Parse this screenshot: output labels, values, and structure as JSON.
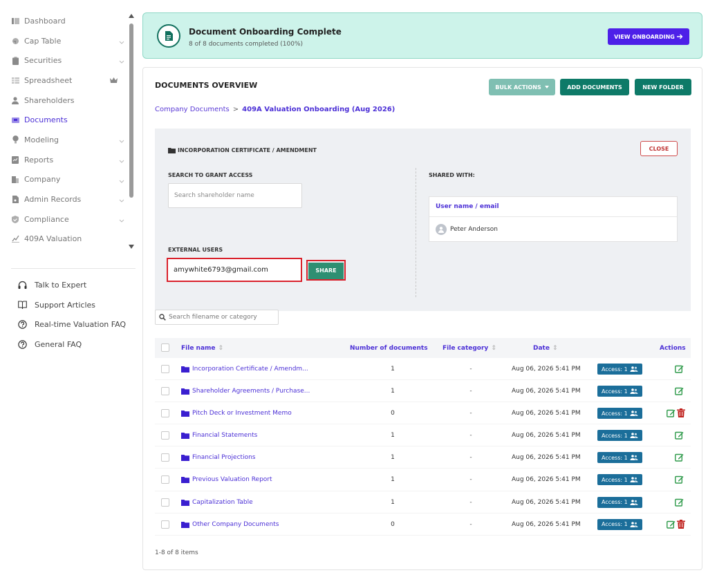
{
  "sidebar": {
    "items": [
      {
        "label": "Dashboard",
        "icon": "dashboard-icon",
        "chevron": false
      },
      {
        "label": "Cap Table",
        "icon": "pie-chart-icon",
        "chevron": true
      },
      {
        "label": "Securities",
        "icon": "clipboard-icon",
        "chevron": true
      },
      {
        "label": "Spreadsheet",
        "icon": "table-icon",
        "chevron": false,
        "badge": "crown-icon"
      },
      {
        "label": "Shareholders",
        "icon": "person-icon",
        "chevron": false
      },
      {
        "label": "Documents",
        "icon": "folder-icon",
        "chevron": false,
        "active": true
      },
      {
        "label": "Modeling",
        "icon": "lightbulb-icon",
        "chevron": true
      },
      {
        "label": "Reports",
        "icon": "report-icon",
        "chevron": true
      },
      {
        "label": "Company",
        "icon": "building-icon",
        "chevron": true
      },
      {
        "label": "Admin Records",
        "icon": "records-icon",
        "chevron": true
      },
      {
        "label": "Compliance",
        "icon": "shield-check-icon",
        "chevron": true
      },
      {
        "label": "409A Valuation",
        "icon": "chart-icon",
        "chevron": false
      }
    ],
    "help": [
      {
        "label": "Talk to Expert",
        "icon": "headset-icon"
      },
      {
        "label": "Support Articles",
        "icon": "book-icon"
      },
      {
        "label": "Real-time Valuation FAQ",
        "icon": "question-icon"
      },
      {
        "label": "General FAQ",
        "icon": "question-icon"
      }
    ]
  },
  "banner": {
    "title": "Document Onboarding Complete",
    "subtitle": "8 of 8 documents completed (100%)",
    "button": "VIEW ONBOARDING"
  },
  "overview": {
    "title": "DOCUMENTS OVERVIEW",
    "bulk_actions": "BULK ACTIONS",
    "add_documents": "ADD DOCUMENTS",
    "new_folder": "NEW FOLDER",
    "breadcrumb": {
      "root": "Company Documents",
      "separator": ">",
      "current": "409A Valuation Onboarding (Aug 2026)"
    }
  },
  "share_panel": {
    "folder_name": "INCORPORATION CERTIFICATE / AMENDMENT",
    "close": "CLOSE",
    "search_label": "SEARCH TO GRANT ACCESS",
    "search_placeholder": "Search shareholder name",
    "external_label": "EXTERNAL USERS",
    "external_value": "amywhite6793@gmail.com",
    "share": "SHARE",
    "shared_with_label": "SHARED WITH:",
    "shared_header": "User name / email",
    "shared_users": [
      "Peter Anderson"
    ]
  },
  "file_search": {
    "placeholder": "Search filename or category"
  },
  "table": {
    "columns": {
      "file_name": "File name",
      "num_docs": "Number of documents",
      "category": "File category",
      "date": "Date",
      "actions": "Actions"
    },
    "rows": [
      {
        "name": "Incorporation Certificate / Amendm...",
        "count": "1",
        "category": "-",
        "date": "Aug 06, 2026 5:41 PM",
        "access": "Access: 1",
        "deletable": false
      },
      {
        "name": "Shareholder Agreements / Purchase...",
        "count": "1",
        "category": "-",
        "date": "Aug 06, 2026 5:41 PM",
        "access": "Access: 1",
        "deletable": false
      },
      {
        "name": "Pitch Deck or Investment Memo",
        "count": "0",
        "category": "-",
        "date": "Aug 06, 2026 5:41 PM",
        "access": "Access: 1",
        "deletable": true
      },
      {
        "name": "Financial Statements",
        "count": "1",
        "category": "-",
        "date": "Aug 06, 2026 5:41 PM",
        "access": "Access: 1",
        "deletable": false
      },
      {
        "name": "Financial Projections",
        "count": "1",
        "category": "-",
        "date": "Aug 06, 2026 5:41 PM",
        "access": "Access: 1",
        "deletable": false
      },
      {
        "name": "Previous Valuation Report",
        "count": "1",
        "category": "-",
        "date": "Aug 06, 2026 5:41 PM",
        "access": "Access: 1",
        "deletable": false
      },
      {
        "name": "Capitalization Table",
        "count": "1",
        "category": "-",
        "date": "Aug 06, 2026 5:41 PM",
        "access": "Access: 1",
        "deletable": false
      },
      {
        "name": "Other Company Documents",
        "count": "0",
        "category": "-",
        "date": "Aug 06, 2026 5:41 PM",
        "access": "Access: 1",
        "deletable": true
      }
    ],
    "pagination": "1-8 of 8 items"
  },
  "colors": {
    "accent": "#4b2fd6",
    "teal": "#0e7a68",
    "banner_bg": "#cdf3ea",
    "access_badge": "#1b6e9a",
    "edit_icon": "#2e9a4a",
    "delete_icon": "#c0221e",
    "highlight": "#d9202a"
  }
}
